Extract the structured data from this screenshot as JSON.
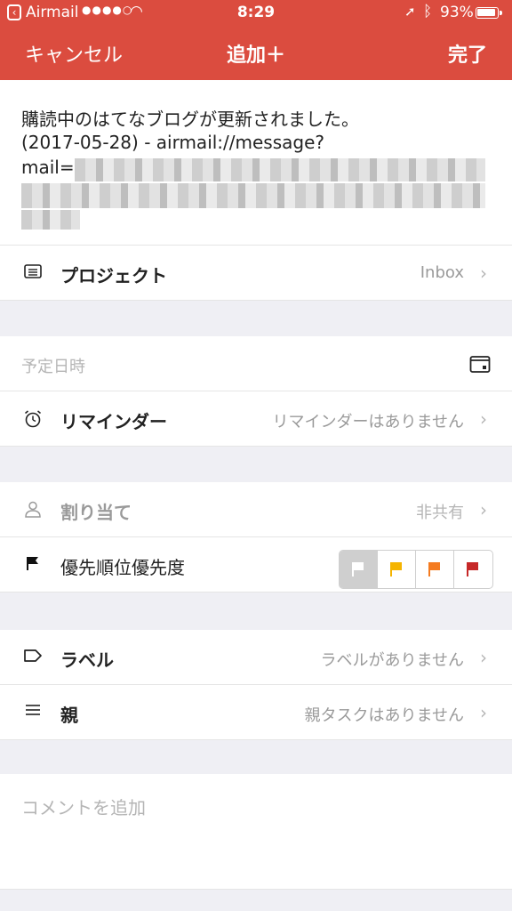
{
  "status_bar": {
    "back_app": "Airmail",
    "time": "8:29",
    "battery": "93%"
  },
  "nav": {
    "cancel": "キャンセル",
    "title": "追加＋",
    "done": "完了"
  },
  "task": {
    "line1": "購読中のはてなブログが更新されました。",
    "line2": "(2017-05-28) - airmail://message?",
    "line3_prefix": "mail="
  },
  "project": {
    "label": "プロジェクト",
    "value": "Inbox",
    "icon": "inbox-icon"
  },
  "due_date": {
    "placeholder": "予定日時",
    "icon": "calendar-icon"
  },
  "reminder": {
    "label": "リマインダー",
    "value": "リマインダーはありません",
    "icon": "alarm-clock-icon"
  },
  "assign": {
    "label": "割り当て",
    "value": "非共有",
    "icon": "person-icon"
  },
  "priority": {
    "label": "優先順位優先度",
    "icon": "flag-icon",
    "selected_index": 0,
    "flags": [
      {
        "name": "priority-4",
        "color": "#ffffff"
      },
      {
        "name": "priority-3",
        "color": "#f5b400"
      },
      {
        "name": "priority-2",
        "color": "#f47b20"
      },
      {
        "name": "priority-1",
        "color": "#c62828"
      }
    ]
  },
  "labels": {
    "label": "ラベル",
    "value": "ラベルがありません",
    "icon": "label-tag-icon"
  },
  "parent": {
    "label": "親",
    "value": "親タスクはありません",
    "icon": "list-lines-icon"
  },
  "comment": {
    "placeholder": "コメントを追加"
  },
  "colors": {
    "accent": "#db4c3f",
    "background": "#efeff4"
  }
}
